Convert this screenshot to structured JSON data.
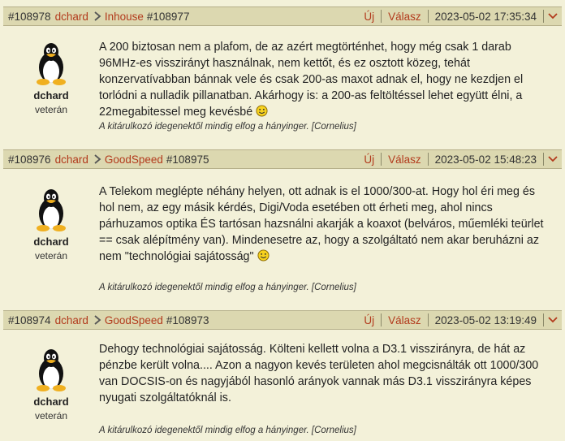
{
  "header_labels": {
    "new": "Új",
    "reply": "Válasz"
  },
  "posts": [
    {
      "id": "#108978",
      "author": "dchard",
      "reply_to_user": "Inhouse",
      "reply_to_id": "#108977",
      "date": "2023-05-02 17:35:34",
      "username": "dchard",
      "rank": "veterán",
      "text": "A 200 biztosan nem a plafom, de az azért megtörténhet, hogy még csak 1 darab 96MHz-es visszirányt használnak, nem kettőt, és ez osztott közeg, tehát konzervatívabban bánnak vele és csak 200-as maxot adnak el, hogy ne kezdjen el torlódni a nulladik pillanatban. Akárhogy is: a 200-as feltöltéssel lehet együtt élni, a 22megabitessel meg kevésbé",
      "signature": "A kitárulkozó idegenektől mindig elfog a hányinger. [Cornelius]"
    },
    {
      "id": "#108976",
      "author": "dchard",
      "reply_to_user": "GoodSpeed",
      "reply_to_id": "#108975",
      "date": "2023-05-02 15:48:23",
      "username": "dchard",
      "rank": "veterán",
      "text": "A Telekom meglépte néhány helyen, ott adnak is el 1000/300-at. Hogy hol éri meg és hol nem, az egy másik kérdés, Digi/Voda esetében ott érheti meg, ahol nincs párhuzamos optika ÉS tartósan hazsnálni akarják a koaxot (belváros, műemléki teürlet == csak alépítmény van). Mindenesetre az, hogy a szolgáltató nem akar beruházni az nem \"technológiai sajátosság\"",
      "signature": "A kitárulkozó idegenektől mindig elfog a hányinger. [Cornelius]"
    },
    {
      "id": "#108974",
      "author": "dchard",
      "reply_to_user": "GoodSpeed",
      "reply_to_id": "#108973",
      "date": "2023-05-02 13:19:49",
      "username": "dchard",
      "rank": "veterán",
      "text": "Dehogy technológiai sajátosság. Költeni kellett volna a D3.1 visszirányra, de hát az pénzbe került volna.... Azon a nagyon kevés területen ahol megcisnálták ott 1000/300 van DOCSIS-on és nagyjából hasonló arányok vannak más D3.1 visszirányra képes nyugati szolgáltatóknál is.",
      "signature": "A kitárulkozó idegenektől mindig elfog a hányinger. [Cornelius]"
    }
  ]
}
